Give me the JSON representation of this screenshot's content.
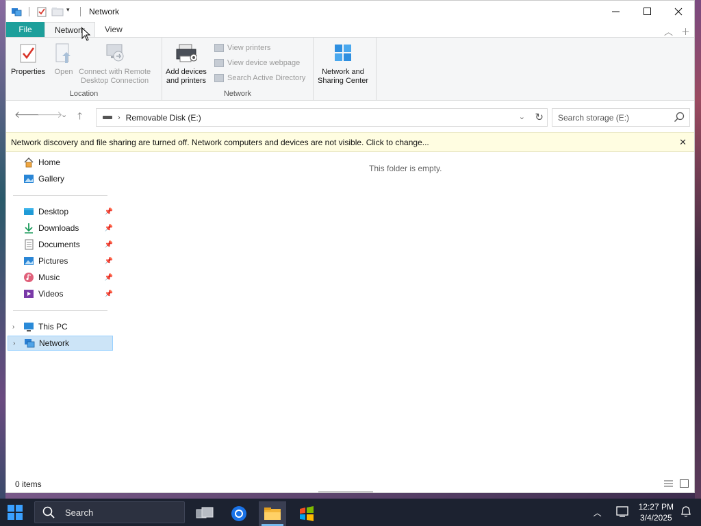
{
  "window": {
    "title": "Network"
  },
  "ribbon": {
    "tabs": [
      "File",
      "Network",
      "View"
    ],
    "active_tab": "Network",
    "groups": {
      "location": {
        "label": "Location",
        "properties": "Properties",
        "open": "Open",
        "remote_line1": "Connect with Remote",
        "remote_line2": "Desktop Connection"
      },
      "network": {
        "label": "Network",
        "add_devices_line1": "Add devices",
        "add_devices_line2": "and printers",
        "view_printers": "View printers",
        "view_webpage": "View device webpage",
        "search_ad": "Search Active Directory"
      },
      "sharing": {
        "line1": "Network and",
        "line2": "Sharing Center"
      }
    }
  },
  "address": {
    "path": "Removable Disk (E:)",
    "search_placeholder": "Search storage (E:)"
  },
  "infobar": {
    "message": "Network discovery and file sharing are turned off. Network computers and devices are not visible. Click to change..."
  },
  "navpane": {
    "quick": [
      {
        "label": "Home",
        "icon": "home-icon"
      },
      {
        "label": "Gallery",
        "icon": "gallery-icon"
      }
    ],
    "pinned": [
      {
        "label": "Desktop",
        "icon": "desktop-icon"
      },
      {
        "label": "Downloads",
        "icon": "downloads-icon"
      },
      {
        "label": "Documents",
        "icon": "documents-icon"
      },
      {
        "label": "Pictures",
        "icon": "pictures-icon"
      },
      {
        "label": "Music",
        "icon": "music-icon"
      },
      {
        "label": "Videos",
        "icon": "videos-icon"
      }
    ],
    "tree": [
      {
        "label": "This PC",
        "icon": "this-pc-icon",
        "selected": false
      },
      {
        "label": "Network",
        "icon": "network-icon",
        "selected": true
      }
    ]
  },
  "content": {
    "empty_message": "This folder is empty."
  },
  "status": {
    "item_count": "0 items"
  },
  "taskbar": {
    "search_label": "Search",
    "time": "12:27 PM",
    "date": "3/4/2025"
  },
  "colors": {
    "file_tab": "#1d9f9b",
    "selection": "#cce4f7",
    "infobar_bg": "#fffde1",
    "taskbar_bg": "#1c2230"
  }
}
